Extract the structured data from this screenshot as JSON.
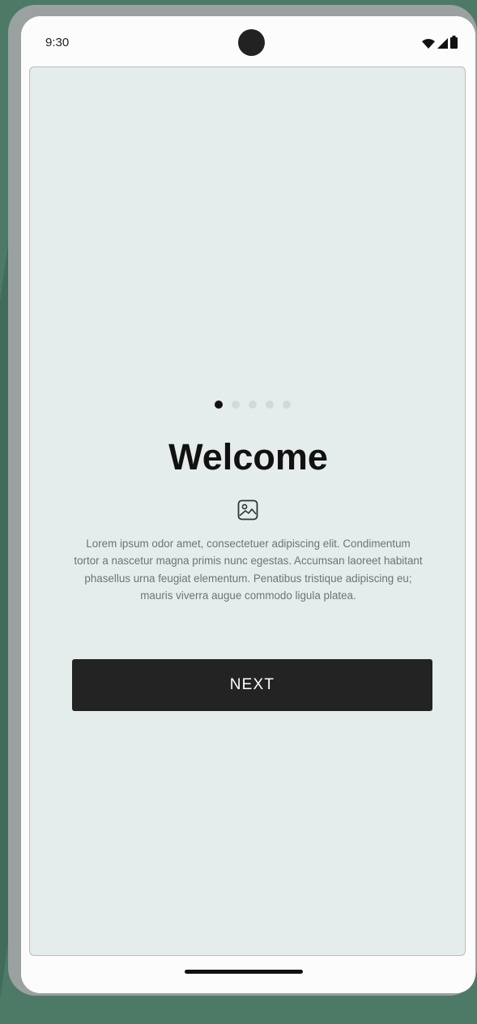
{
  "status_bar": {
    "time": "9:30",
    "icons": [
      "wifi-icon",
      "signal-icon",
      "battery-icon"
    ]
  },
  "onboarding": {
    "page_indicator": {
      "total": 5,
      "active_index": 0
    },
    "title": "Welcome",
    "image_icon": "image-placeholder-icon",
    "body": "Lorem ipsum odor amet, consectetuer adipiscing elit. Condimentum tortor a nascetur magna primis nunc egestas. Accumsan laoreet habitant phasellus urna feugiat elementum. Penatibus tristique adipiscing eu; mauris viverra augue commodo ligula platea.",
    "next_label": "NEXT"
  },
  "colors": {
    "background": "#4d7a66",
    "device_frame": "#9aa1a0",
    "content_bg": "#e5ecec",
    "button_bg": "#232323",
    "active_dot": "#111111",
    "inactive_dot": "#d3d8d8"
  }
}
